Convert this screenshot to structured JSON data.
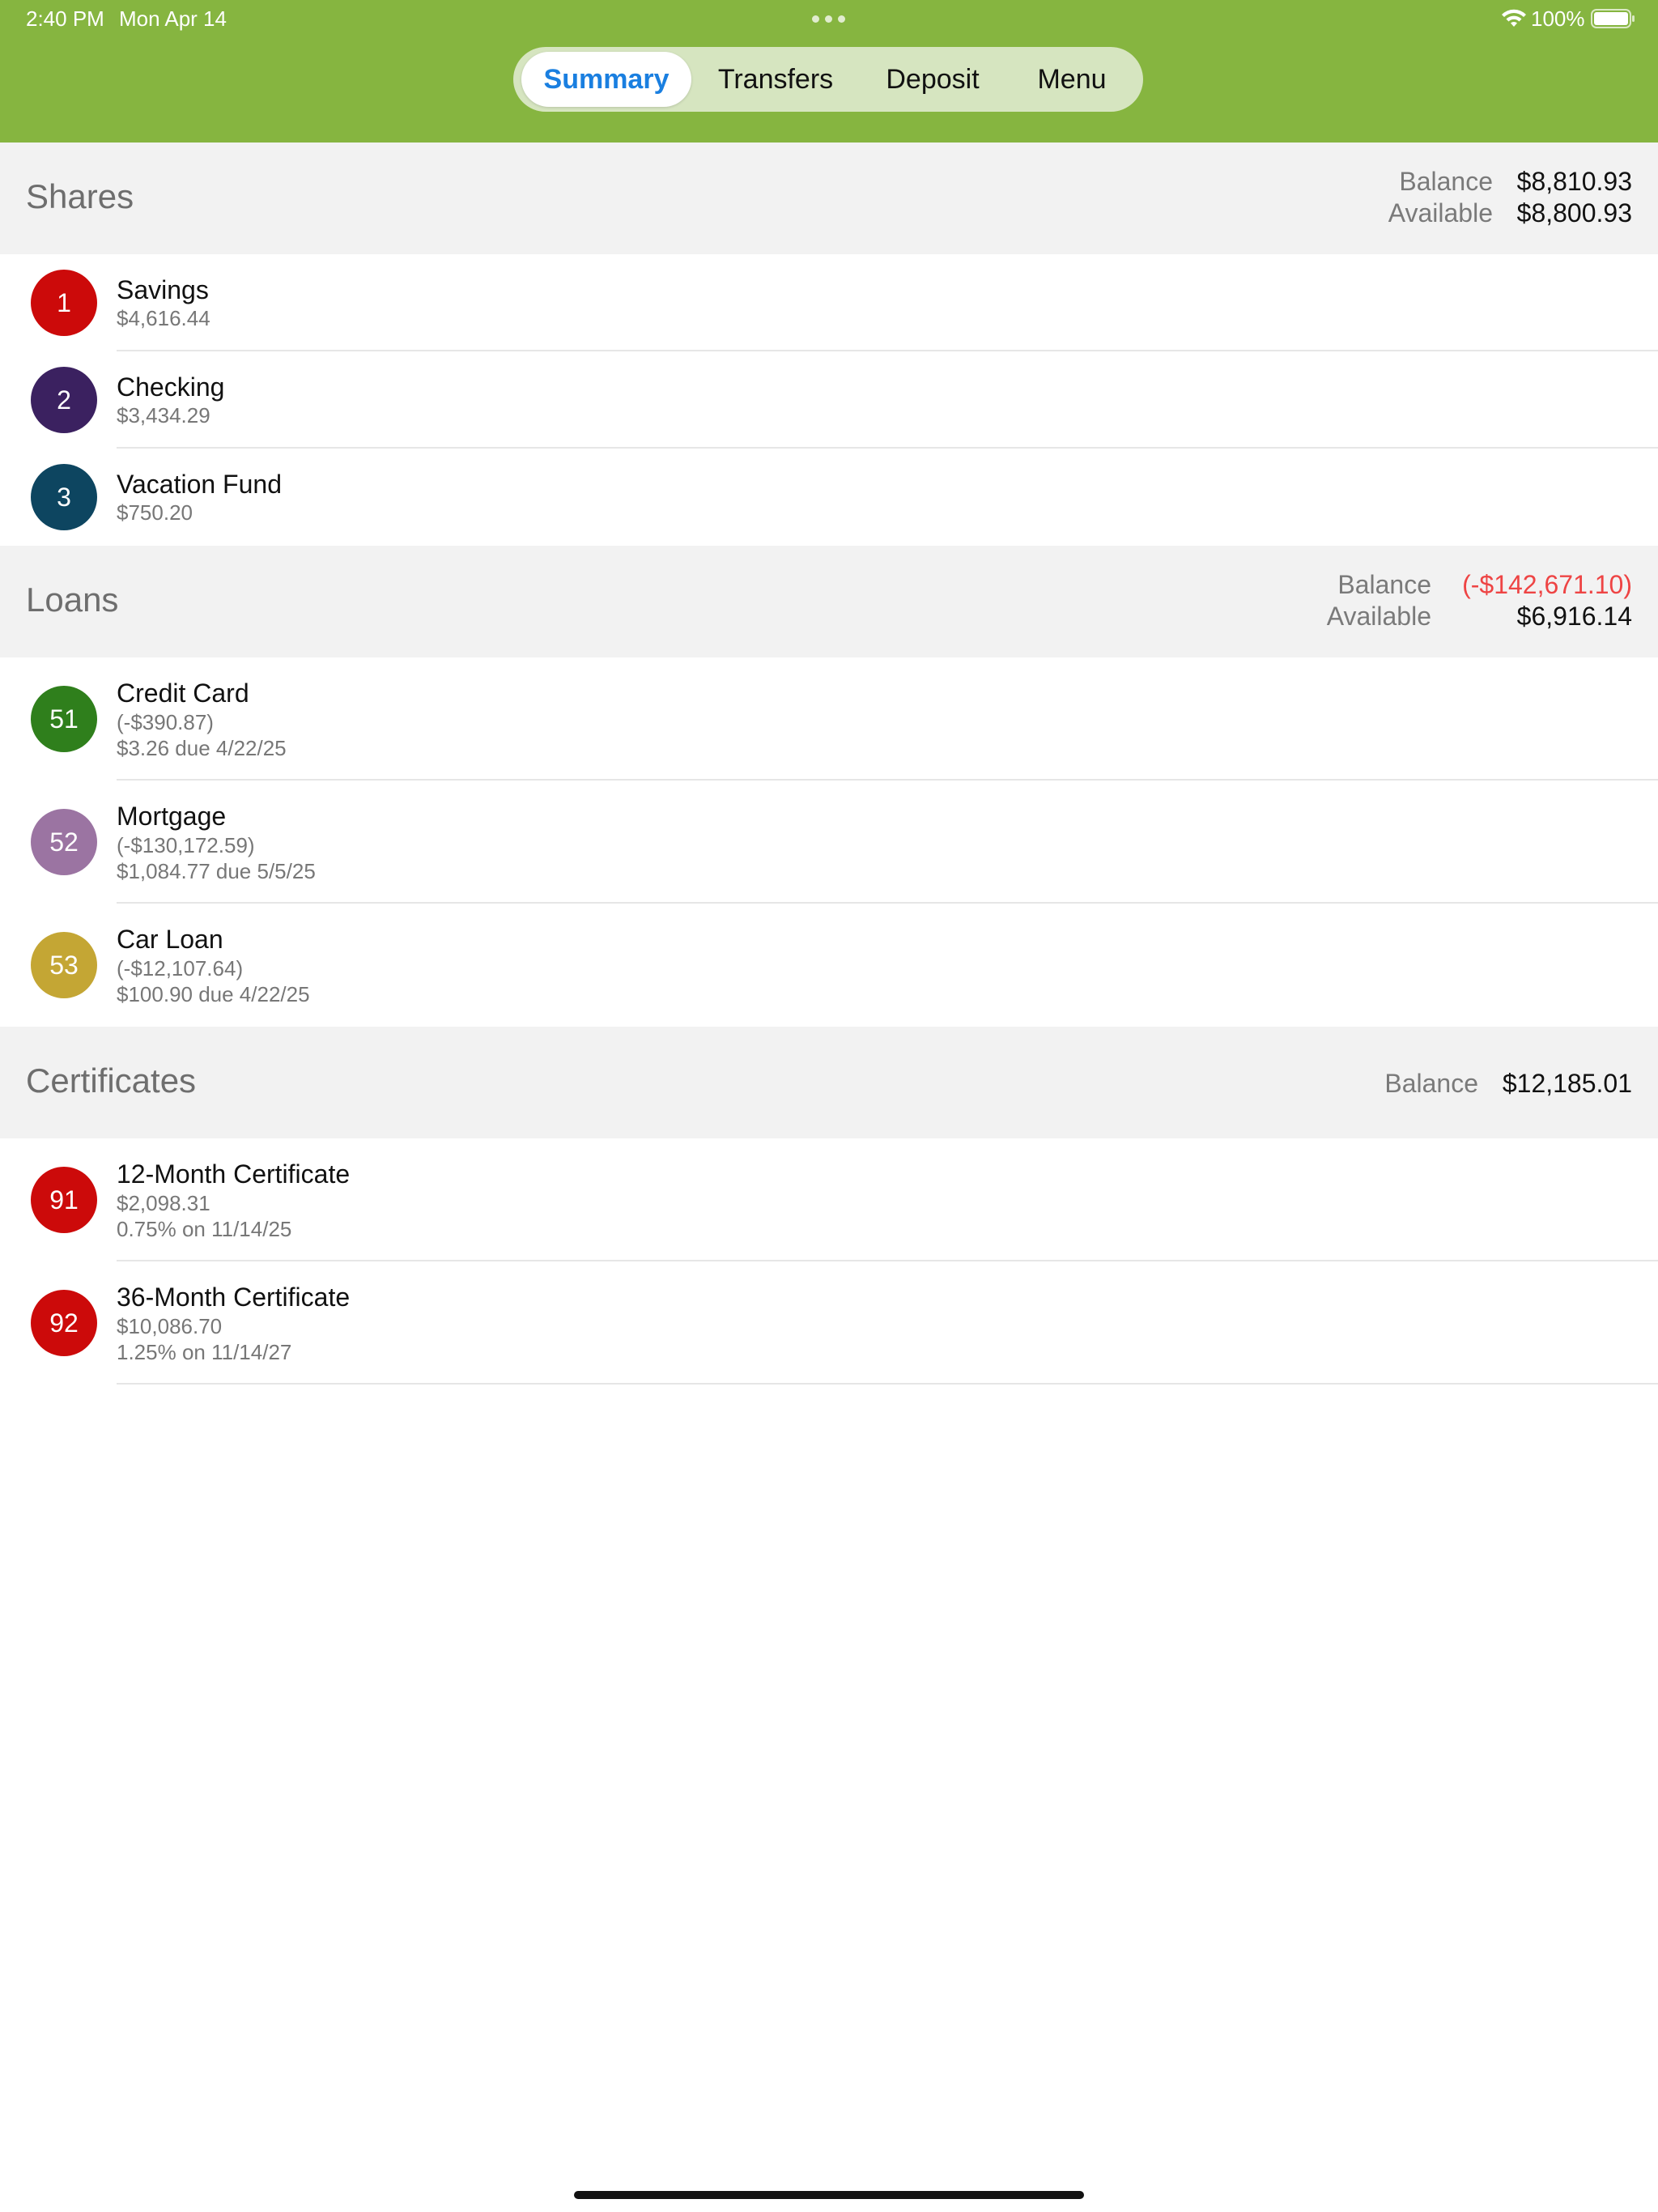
{
  "status_bar": {
    "time": "2:40 PM",
    "date": "Mon Apr 14",
    "battery": "100%"
  },
  "tabs": [
    {
      "label": "Summary",
      "selected": true
    },
    {
      "label": "Transfers",
      "selected": false
    },
    {
      "label": "Deposit",
      "selected": false
    },
    {
      "label": "Menu",
      "selected": false
    }
  ],
  "colors": {
    "brand_green": "#86b540",
    "active_tab": "#1a7fe0",
    "negative": "#ee4444"
  },
  "shares": {
    "title": "Shares",
    "balance_label": "Balance",
    "balance_value": "$8,810.93",
    "available_label": "Available",
    "available_value": "$8,800.93",
    "accounts": [
      {
        "id": "1",
        "name": "Savings",
        "amount": "$4,616.44",
        "color": "#cc0a0a"
      },
      {
        "id": "2",
        "name": "Checking",
        "amount": "$3,434.29",
        "color": "#3b2160"
      },
      {
        "id": "3",
        "name": "Vacation Fund",
        "amount": "$750.20",
        "color": "#0d4560"
      }
    ]
  },
  "loans": {
    "title": "Loans",
    "balance_label": "Balance",
    "balance_value": "(-$142,671.10)",
    "available_label": "Available",
    "available_value": "$6,916.14",
    "accounts": [
      {
        "id": "51",
        "name": "Credit Card",
        "amount": "(-$390.87)",
        "detail": "$3.26 due 4/22/25",
        "color": "#2f7f1c"
      },
      {
        "id": "52",
        "name": "Mortgage",
        "amount": "(-$130,172.59)",
        "detail": "$1,084.77 due 5/5/25",
        "color": "#9b74a2"
      },
      {
        "id": "53",
        "name": "Car Loan",
        "amount": "(-$12,107.64)",
        "detail": "$100.90 due 4/22/25",
        "color": "#c4a634"
      }
    ]
  },
  "certificates": {
    "title": "Certificates",
    "balance_label": "Balance",
    "balance_value": "$12,185.01",
    "accounts": [
      {
        "id": "91",
        "name": "12-Month Certificate",
        "amount": "$2,098.31",
        "detail": "0.75% on 11/14/25",
        "color": "#cc0a0a"
      },
      {
        "id": "92",
        "name": "36-Month Certificate",
        "amount": "$10,086.70",
        "detail": "1.25% on 11/14/27",
        "color": "#cc0a0a"
      }
    ]
  }
}
